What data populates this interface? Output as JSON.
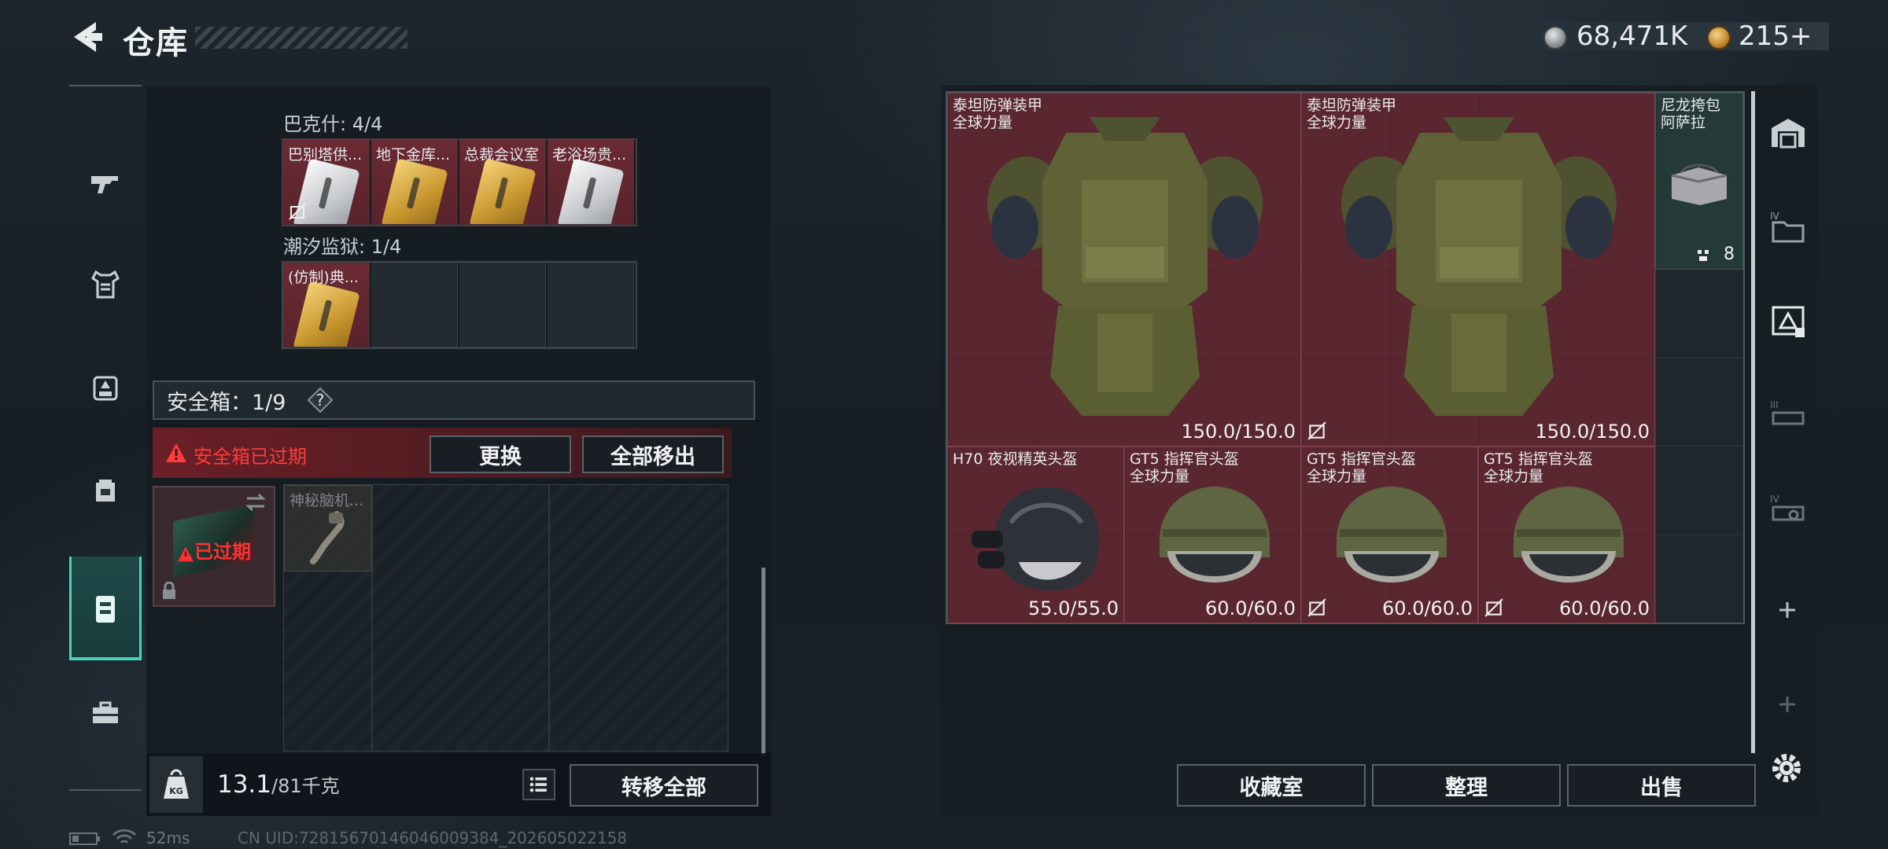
{
  "header": {
    "title": "仓库",
    "currency1": "68,471K",
    "currency2": "215+"
  },
  "left_rail": {
    "items": [
      "gun-icon",
      "armor-icon",
      "chest-rig-icon",
      "backpack-icon",
      "safe-case-icon",
      "toolbox-icon"
    ],
    "active": "safe-case-icon"
  },
  "inventory": {
    "group1": {
      "label": "巴克什: 4/4",
      "items": [
        {
          "label": "巴别塔供...",
          "card": "silver",
          "nolock": true
        },
        {
          "label": "地下金库...",
          "card": "gold",
          "nolock": false
        },
        {
          "label": "总裁会议室",
          "card": "gold",
          "nolock": false
        },
        {
          "label": "老浴场贵...",
          "card": "silver",
          "nolock": false
        }
      ]
    },
    "group2": {
      "label": "潮汐监狱: 1/4",
      "items": [
        {
          "label": "(仿制)典...",
          "card": "gold"
        }
      ]
    },
    "safe_box": {
      "title": "安全箱：1/9",
      "expired_msg": "安全箱已过期",
      "replace_label": "更换",
      "remove_all_label": "全部移出",
      "expired_tag": "已过期",
      "item_label": "神秘脑机..."
    },
    "weight": {
      "current": "13.1",
      "max": "/81千克"
    },
    "transfer_all_label": "转移全部"
  },
  "stash": {
    "items": [
      {
        "name": "泰坦防弹装甲\n全球力量",
        "durability": "150.0/150.0",
        "nolock": false
      },
      {
        "name": "泰坦防弹装甲\n全球力量",
        "durability": "150.0/150.0",
        "nolock": true
      },
      {
        "name": "尼龙挎包\n阿萨拉",
        "count": "8"
      },
      {
        "name": "H70 夜视精英头盔",
        "durability": "55.0/55.0",
        "nolock": false
      },
      {
        "name": "GT5 指挥官头盔\n全球力量",
        "durability": "60.0/60.0",
        "nolock": false
      },
      {
        "name": "GT5 指挥官头盔\n全球力量",
        "durability": "60.0/60.0",
        "nolock": true
      },
      {
        "name": "GT5 指挥官头盔\n全球力量",
        "durability": "60.0/60.0",
        "nolock": true
      }
    ],
    "buttons": {
      "collection": "收藏室",
      "sort": "整理",
      "sell": "出售"
    }
  },
  "status_bar": {
    "ping": "52ms",
    "uid": "CN UID:7281567014604600938​4_202605022158"
  },
  "colors": {
    "accent": "#48d4b8",
    "item_red": "#5a2730",
    "expired_red": "#ff3b3b"
  }
}
